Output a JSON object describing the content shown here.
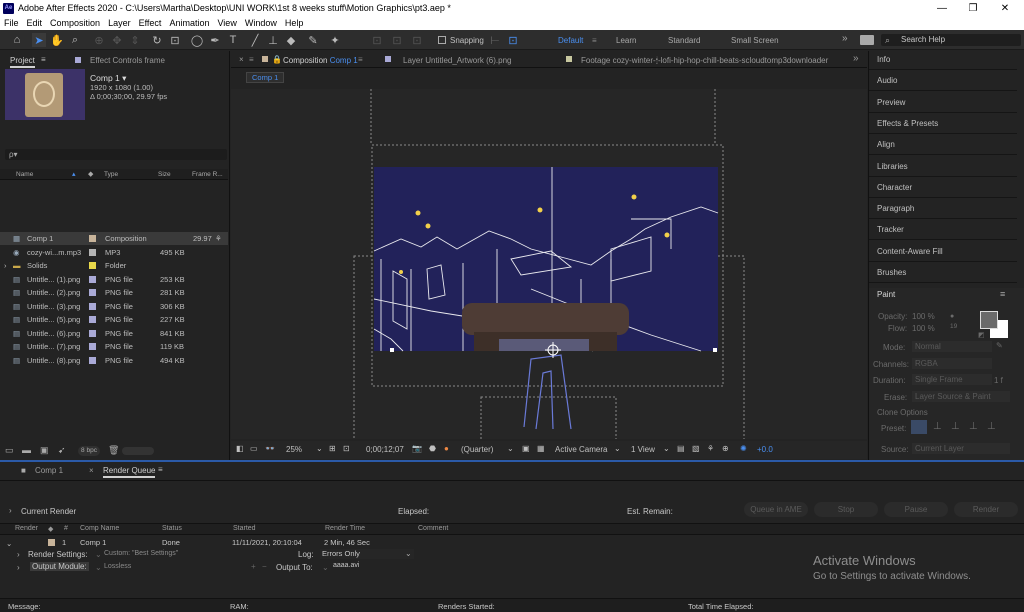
{
  "window": {
    "app_icon": "Ae",
    "title": "Adobe After Effects 2020 - C:\\Users\\Martha\\Desktop\\UNI WORK\\1st 8 weeks stuff\\Motion Graphics\\pt3.aep *",
    "minimize": "—",
    "maximize": "❐",
    "close": "✕"
  },
  "menu": [
    "File",
    "Edit",
    "Composition",
    "Layer",
    "Effect",
    "Animation",
    "View",
    "Window",
    "Help"
  ],
  "toolbar": {
    "snapping_label": "Snapping",
    "workspaces": [
      "Default",
      "Learn",
      "Standard",
      "Small Screen"
    ],
    "active_workspace": "Default",
    "search_placeholder": "Search Help",
    "more": "»"
  },
  "project_panel": {
    "tab_project": "Project",
    "tab_effect_controls": "Effect Controls frame",
    "comp_name": "Comp 1 ▾",
    "comp_size": "1920 x 1080 (1.00)",
    "comp_duration": "Δ 0;00;30;00, 29.97 fps",
    "search_placeholder": "ρ▾",
    "columns": {
      "name": "Name",
      "type": "Type",
      "size": "Size",
      "frame_rate": "Frame R..."
    },
    "items": [
      {
        "name": "Comp 1",
        "type": "Composition",
        "size": "",
        "rate": "29.97",
        "color": "#c8b49a",
        "icon": "comp-icon",
        "selected": true
      },
      {
        "name": "cozy-wi...m.mp3",
        "type": "MP3",
        "size": "495 KB",
        "rate": "",
        "color": "#b4b4b4",
        "icon": "audio-file-icon",
        "selected": false
      },
      {
        "name": "Solids",
        "type": "Folder",
        "size": "",
        "rate": "",
        "color": "#e8d84a",
        "icon": "folder-icon",
        "selected": false
      },
      {
        "name": "Untitle... (1).png",
        "type": "PNG file",
        "size": "253 KB",
        "rate": "",
        "color": "#a9a9d6",
        "icon": "png-file-icon",
        "selected": false
      },
      {
        "name": "Untitle... (2).png",
        "type": "PNG file",
        "size": "281 KB",
        "rate": "",
        "color": "#a9a9d6",
        "icon": "png-file-icon",
        "selected": false
      },
      {
        "name": "Untitle... (3).png",
        "type": "PNG file",
        "size": "306 KB",
        "rate": "",
        "color": "#a9a9d6",
        "icon": "png-file-icon",
        "selected": false
      },
      {
        "name": "Untitle... (5).png",
        "type": "PNG file",
        "size": "227 KB",
        "rate": "",
        "color": "#a9a9d6",
        "icon": "png-file-icon",
        "selected": false
      },
      {
        "name": "Untitle... (6).png",
        "type": "PNG file",
        "size": "841 KB",
        "rate": "",
        "color": "#a9a9d6",
        "icon": "png-file-icon",
        "selected": false
      },
      {
        "name": "Untitle... (7).png",
        "type": "PNG file",
        "size": "119 KB",
        "rate": "",
        "color": "#a9a9d6",
        "icon": "png-file-icon",
        "selected": false
      },
      {
        "name": "Untitle... (8).png",
        "type": "PNG file",
        "size": "494 KB",
        "rate": "",
        "color": "#a9a9d6",
        "icon": "png-file-icon",
        "selected": false
      }
    ],
    "bpc": "8 bpc"
  },
  "viewer": {
    "tab_composition_prefix": "Composition",
    "tab_composition_name": "Comp 1",
    "tab_layer": "Layer  Untitled_Artwork (6).png",
    "tab_footage": "Footage  cozy-winter-🕯-lofi-hip-hop-chill-beats-scloudtomp3downloader",
    "comp_pill": "Comp 1",
    "zoom": "25%",
    "timecode": "0;00;12;07",
    "resolution": "(Quarter)",
    "camera": "Active Camera",
    "views": "1 View",
    "exposure": "+0.0",
    "canvas_color": "#22225a"
  },
  "right_panel": {
    "items": [
      "Info",
      "Audio",
      "Preview",
      "Effects & Presets",
      "Align",
      "Libraries",
      "Character",
      "Paragraph",
      "Tracker",
      "Content-Aware Fill",
      "Brushes"
    ],
    "paint": {
      "title": "Paint",
      "opacity_label": "Opacity:",
      "opacity_value": "100 %",
      "flow_label": "Flow:",
      "flow_value": "100 %",
      "brush_size": "19",
      "mode_label": "Mode:",
      "mode_value": "Normal",
      "channels_label": "Channels:",
      "channels_value": "RGBA",
      "duration_label": "Duration:",
      "duration_value": "Single Frame",
      "duration_extra": "1  f",
      "erase_label": "Erase:",
      "erase_value": "Layer Source & Paint",
      "clone_options": "Clone Options",
      "preset_label": "Preset:",
      "source_label": "Source:",
      "source_value": "Current Layer"
    }
  },
  "bottom": {
    "tab_comp": "Comp 1",
    "tab_render_queue": "Render Queue",
    "current_render": "Current Render",
    "elapsed": "Elapsed:",
    "est_remain": "Est. Remain:",
    "buttons": [
      "Queue in AME",
      "Stop",
      "Pause",
      "Render"
    ],
    "columns": {
      "render": "Render",
      "num": "#",
      "comp_name": "Comp Name",
      "status": "Status",
      "started": "Started",
      "render_time": "Render Time",
      "comment": "Comment"
    },
    "job": {
      "num": "1",
      "comp": "Comp 1",
      "status": "Done",
      "started": "11/11/2021, 20:10:04",
      "render_time": "2 Min, 46 Sec"
    },
    "render_settings_label": "Render Settings:",
    "render_settings_value": "Custom: \"Best Settings\"",
    "log_label": "Log:",
    "log_value": "Errors Only",
    "output_module_label": "Output Module:",
    "output_module_value": "Lossless",
    "output_to_label": "Output To:",
    "output_to_value": "aaaa.avi",
    "status_message": "Message:",
    "status_ram": "RAM:",
    "status_renders_started": "Renders Started:",
    "status_total_elapsed": "Total Time Elapsed:",
    "activate_title": "Activate Windows",
    "activate_sub": "Go to Settings to activate Windows."
  }
}
